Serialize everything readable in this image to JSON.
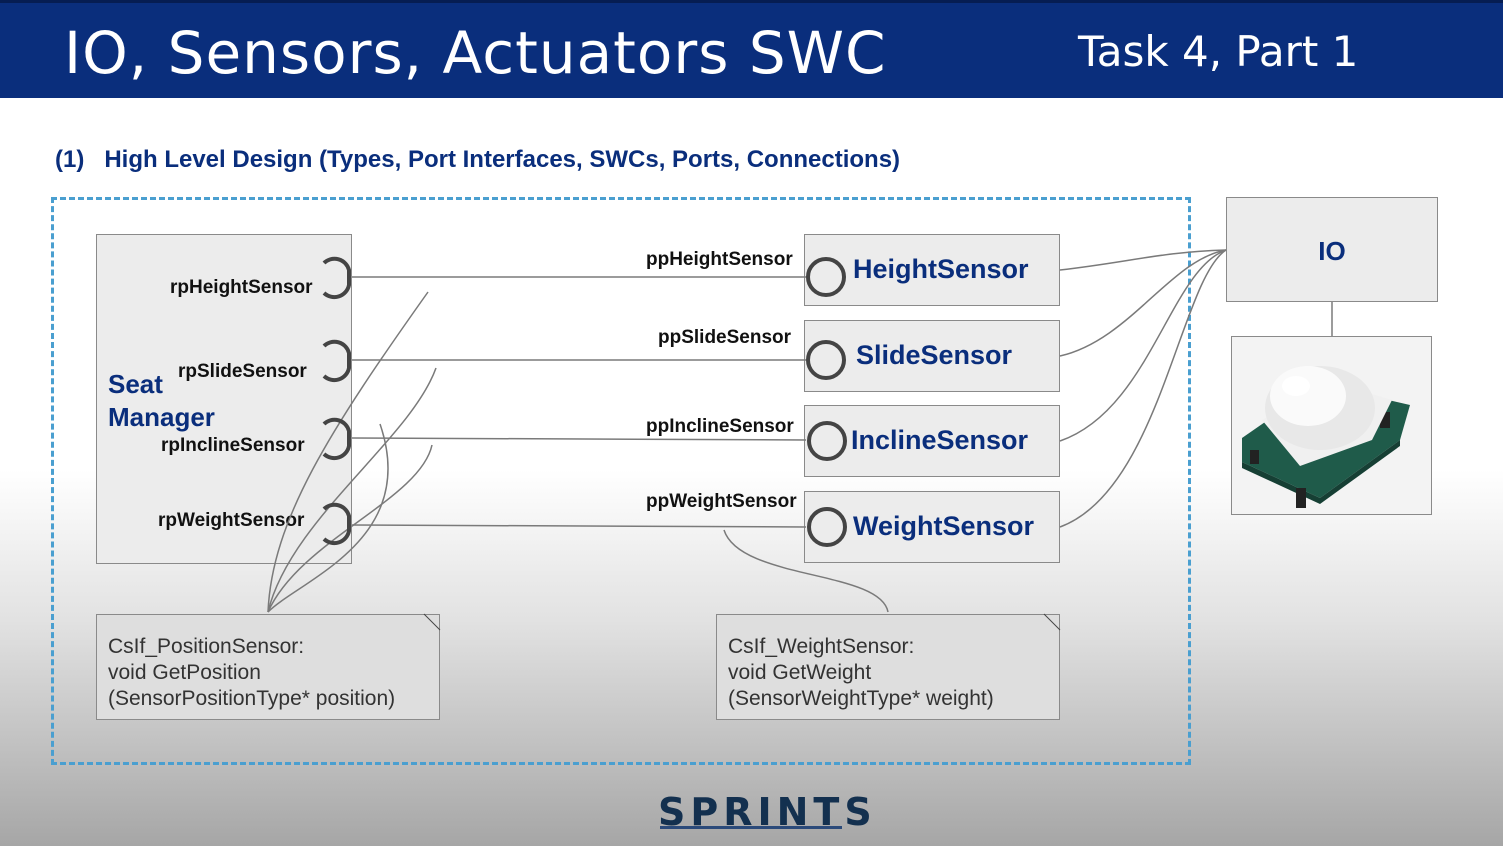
{
  "header": {
    "title": "IO, Sensors, Actuators SWC",
    "task": "Task 4, Part 1"
  },
  "subtitle": "(1)   High Level Design (Types, Port Interfaces, SWCs, Ports, Connections)",
  "seat_manager": {
    "name_line1": "Seat",
    "name_line2": "Manager",
    "ports": [
      "rpHeightSensor",
      "rpSlideSensor",
      "rpInclineSensor",
      "rpWeightSensor"
    ]
  },
  "sensors": [
    {
      "port": "ppHeightSensor",
      "name": "HeightSensor"
    },
    {
      "port": "ppSlideSensor",
      "name": "SlideSensor"
    },
    {
      "port": "ppInclineSensor",
      "name": "InclineSensor"
    },
    {
      "port": "ppWeightSensor",
      "name": "WeightSensor"
    }
  ],
  "io": {
    "label": "IO"
  },
  "notes": {
    "position": [
      "CsIf_PositionSensor:",
      "void GetPosition",
      "(SensorPositionType* position)"
    ],
    "weight": [
      "CsIf_WeightSensor:",
      "void GetWeight",
      "(SensorWeightType* weight)"
    ]
  },
  "logo": "SPRINTS",
  "colors": {
    "header_bg": "#0a2e7c",
    "accent_text": "#0a2e7c",
    "dashed_frame": "#4a9fd0"
  },
  "icons": {
    "sensor_image": "pir-motion-sensor-icon",
    "port_provider": "circle-port-icon",
    "port_requester": "half-circle-port-icon"
  }
}
